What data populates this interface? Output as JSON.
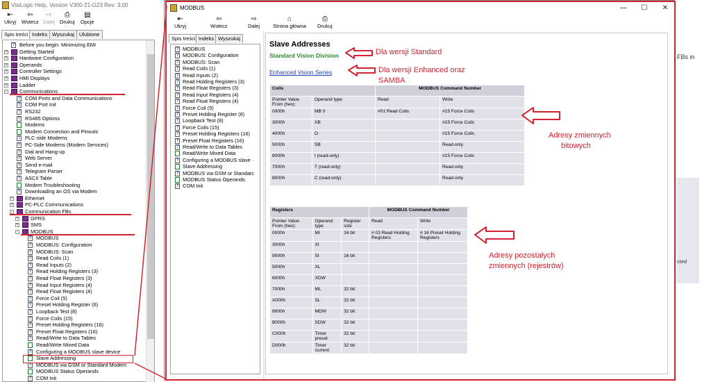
{
  "bg_window": {
    "title": "VisiLogic Help, Version V300-21-G23 Rev: 3.00",
    "toolbar": [
      {
        "label": "Ukryj",
        "enabled": true
      },
      {
        "label": "Wstecz",
        "enabled": true
      },
      {
        "label": "Dalej",
        "enabled": false
      },
      {
        "label": "Drukuj",
        "enabled": true
      },
      {
        "label": "Opcje",
        "enabled": true
      }
    ],
    "tabs": [
      "Spis treści",
      "Indeks",
      "Wyszukaj",
      "Ulubione"
    ],
    "tree": [
      {
        "label": "Before you begin: Minimizing EMI",
        "indent": 1,
        "kind": "page"
      },
      {
        "label": "Getting Started",
        "indent": 0,
        "kind": "book",
        "exp": "+"
      },
      {
        "label": "Hardware Configuration",
        "indent": 0,
        "kind": "book",
        "exp": "+"
      },
      {
        "label": "Operands",
        "indent": 0,
        "kind": "book",
        "exp": "+"
      },
      {
        "label": "Controller Settings",
        "indent": 0,
        "kind": "book",
        "exp": "+"
      },
      {
        "label": "HMI Displays",
        "indent": 0,
        "kind": "book",
        "exp": "+"
      },
      {
        "label": "Ladder",
        "indent": 0,
        "kind": "book",
        "exp": "+"
      },
      {
        "label": "Communications",
        "indent": 0,
        "kind": "open",
        "exp": "-"
      },
      {
        "label": "COM Ports and Data Communications",
        "indent": 2,
        "kind": "page"
      },
      {
        "label": "COM Port Init",
        "indent": 2,
        "kind": "page"
      },
      {
        "label": "RS232",
        "indent": 2,
        "kind": "page"
      },
      {
        "label": "RS485 Options",
        "indent": 2,
        "kind": "page"
      },
      {
        "label": "Modems",
        "indent": 2,
        "kind": "anim"
      },
      {
        "label": "Modem Connection and Pinouts",
        "indent": 2,
        "kind": "anim"
      },
      {
        "label": "PLC-side Modems",
        "indent": 2,
        "kind": "page"
      },
      {
        "label": "PC-Side Modems (Modem Services)",
        "indent": 2,
        "kind": "page"
      },
      {
        "label": "Dial and Hang-up",
        "indent": 2,
        "kind": "page"
      },
      {
        "label": "Web Server",
        "indent": 2,
        "kind": "page"
      },
      {
        "label": "Send e-mail",
        "indent": 2,
        "kind": "page"
      },
      {
        "label": "Telegram Parser",
        "indent": 2,
        "kind": "page"
      },
      {
        "label": "ASCII Table",
        "indent": 2,
        "kind": "page"
      },
      {
        "label": "Modem Troubleshooting",
        "indent": 2,
        "kind": "anim"
      },
      {
        "label": "Downloading an OS via Modem",
        "indent": 2,
        "kind": "page"
      },
      {
        "label": "Ethernet",
        "indent": 1,
        "kind": "book",
        "exp": "+"
      },
      {
        "label": "PC-PLC Communications",
        "indent": 1,
        "kind": "book",
        "exp": "+"
      },
      {
        "label": "Communication FBs",
        "indent": 1,
        "kind": "open",
        "exp": "-"
      },
      {
        "label": "GPRS",
        "indent": 2,
        "kind": "book",
        "exp": "+"
      },
      {
        "label": "SMS",
        "indent": 2,
        "kind": "book",
        "exp": "+"
      },
      {
        "label": "MODBUS",
        "indent": 2,
        "kind": "open",
        "exp": "-"
      },
      {
        "label": "MODBUS",
        "indent": 4,
        "kind": "page"
      },
      {
        "label": "MODBUS: Configuration",
        "indent": 4,
        "kind": "page"
      },
      {
        "label": "MODBUS: Scan",
        "indent": 4,
        "kind": "page"
      },
      {
        "label": "Read Coils (1)",
        "indent": 4,
        "kind": "page"
      },
      {
        "label": "Read Inputs (2)",
        "indent": 4,
        "kind": "page"
      },
      {
        "label": "Read Holding Registers (3)",
        "indent": 4,
        "kind": "page"
      },
      {
        "label": "Read Float Registers (3)",
        "indent": 4,
        "kind": "page"
      },
      {
        "label": "Read Input Registers (4)",
        "indent": 4,
        "kind": "page"
      },
      {
        "label": "Read Float Registers (4)",
        "indent": 4,
        "kind": "page"
      },
      {
        "label": "Force Coil (5)",
        "indent": 4,
        "kind": "page"
      },
      {
        "label": "Preset Holding Register (6)",
        "indent": 4,
        "kind": "page"
      },
      {
        "label": "Loopback Test (8)",
        "indent": 4,
        "kind": "page"
      },
      {
        "label": "Force Coils (15)",
        "indent": 4,
        "kind": "page"
      },
      {
        "label": "Preset Holding Registers (16)",
        "indent": 4,
        "kind": "page"
      },
      {
        "label": "Preset Float Registers (16)",
        "indent": 4,
        "kind": "page"
      },
      {
        "label": "Read/Write to Data Tables",
        "indent": 4,
        "kind": "page"
      },
      {
        "label": "Read/Write Mixed Data",
        "indent": 4,
        "kind": "anim"
      },
      {
        "label": "Configuring a MODBUS slave device",
        "indent": 4,
        "kind": "page"
      },
      {
        "label": "Slave Addressing",
        "indent": 4,
        "kind": "anim"
      },
      {
        "label": "MODBUS via GSM or Standard Modem",
        "indent": 4,
        "kind": "page"
      },
      {
        "label": "MODBUS Status Operands",
        "indent": 4,
        "kind": "anim"
      },
      {
        "label": "COM Init",
        "indent": 4,
        "kind": "page"
      }
    ],
    "right_fragment": "FBs in",
    "right_fragment2": "cted"
  },
  "fg_window": {
    "title": "MODBUS",
    "toolbar": [
      {
        "label": "Ukryj",
        "icon": "hide-icon"
      },
      {
        "label": "Wstecz",
        "icon": "back-icon"
      },
      {
        "label": "Dalej",
        "icon": "forward-icon"
      },
      {
        "label": "Strona główna",
        "icon": "home-icon"
      },
      {
        "label": "Drukuj",
        "icon": "print-icon"
      }
    ],
    "tabs": [
      "Spis treści",
      "Indeks",
      "Wyszukaj"
    ],
    "tree": [
      {
        "label": "MODBUS",
        "kind": "page"
      },
      {
        "label": "MODBUS: Configuration",
        "kind": "page"
      },
      {
        "label": "MODBUS: Scan",
        "kind": "page"
      },
      {
        "label": "Read Coils (1)",
        "kind": "page"
      },
      {
        "label": "Read Inputs (2)",
        "kind": "page"
      },
      {
        "label": "Read Holding Registers (3)",
        "kind": "page"
      },
      {
        "label": "Read Float Registers (3)",
        "kind": "page"
      },
      {
        "label": "Read Input Registers (4)",
        "kind": "page"
      },
      {
        "label": "Read Float Registers (4)",
        "kind": "page"
      },
      {
        "label": "Force Coil (5)",
        "kind": "page"
      },
      {
        "label": "Preset Holding Register (6)",
        "kind": "page"
      },
      {
        "label": "Loopback Test (8)",
        "kind": "page"
      },
      {
        "label": "Force Coils (15)",
        "kind": "page"
      },
      {
        "label": "Preset Holding Registers (16)",
        "kind": "page"
      },
      {
        "label": "Preset Float Registers (16)",
        "kind": "page"
      },
      {
        "label": "Read/Write to Data Tables",
        "kind": "page"
      },
      {
        "label": "Read/Write Mixed Data",
        "kind": "anim"
      },
      {
        "label": "Configuring a MODBUS slave ·",
        "kind": "page"
      },
      {
        "label": "Slave Addressing",
        "kind": "anim"
      },
      {
        "label": "MODBUS via GSM or Standarc",
        "kind": "page"
      },
      {
        "label": "MODBUS Status Operands",
        "kind": "anim"
      },
      {
        "label": "COM Init",
        "kind": "page"
      }
    ],
    "content": {
      "title": "Slave Addresses",
      "standard_link": "Standard Vision Division",
      "enhanced_link": "Enhanced Vision Series",
      "coils": {
        "header": [
          "Coils",
          "MODBUS Command Number"
        ],
        "subheader": [
          "Pointer Value From (hex):",
          "Operand type",
          "Read",
          "Write"
        ],
        "rows": [
          [
            "0000h",
            "MB 0",
            "#01 Read Coils",
            "#15 Force Coils"
          ],
          [
            "3000h",
            "XB",
            "",
            "#15 Force Coils"
          ],
          [
            "4000h",
            "O",
            "",
            "#15 Force Coils"
          ],
          [
            "5000h",
            "SB",
            "",
            "Read-only"
          ],
          [
            "6000h",
            "I (read-only)",
            "",
            "#15 Force Coils"
          ],
          [
            "7000h",
            "T (read-only)",
            "",
            "Read-only"
          ],
          [
            "8000h",
            "C (read-only)",
            "",
            "Read-only"
          ]
        ]
      },
      "registers": {
        "header": [
          "Registers",
          "MODBUS Command Number"
        ],
        "subheader": [
          "Pointer Value From (hex):",
          "Operand type",
          "Register size",
          "Read",
          "Write"
        ],
        "rows": [
          [
            "0000h",
            "MI",
            "16 bit",
            "# 03 Read Holding Registers",
            "# 16 Preset Holding Registers"
          ],
          [
            "3000h",
            "XI",
            "",
            "",
            ""
          ],
          [
            "9000h",
            "SI",
            "16 bit",
            "",
            ""
          ],
          [
            "5000h",
            "XL",
            "",
            "",
            ""
          ],
          [
            "6000h",
            "XDW",
            "",
            "",
            ""
          ],
          [
            "7000h",
            "ML",
            "32 bit",
            "",
            ""
          ],
          [
            "A000h",
            "SL",
            "32 bit",
            "",
            ""
          ],
          [
            "8000h",
            "MDW",
            "32 bit",
            "",
            ""
          ],
          [
            "B000h",
            "SDW",
            "32 bit",
            "",
            ""
          ],
          [
            "C000h",
            "Timer preset",
            "32 bit",
            "",
            ""
          ],
          [
            "D000h",
            "Timer current",
            "32 bit",
            "",
            ""
          ]
        ]
      }
    }
  },
  "annotations": {
    "standard": "Dla wersji Standard",
    "enhanced_1": "Dla wersji Enhanced oraz",
    "enhanced_2": "SAMBA",
    "bit_1": "Adresy zmiennych",
    "bit_2": "bitowych",
    "reg_1": "Adresy pozostałych",
    "reg_2": "zmiennych (rejestrów)",
    "color": "#d32331"
  }
}
